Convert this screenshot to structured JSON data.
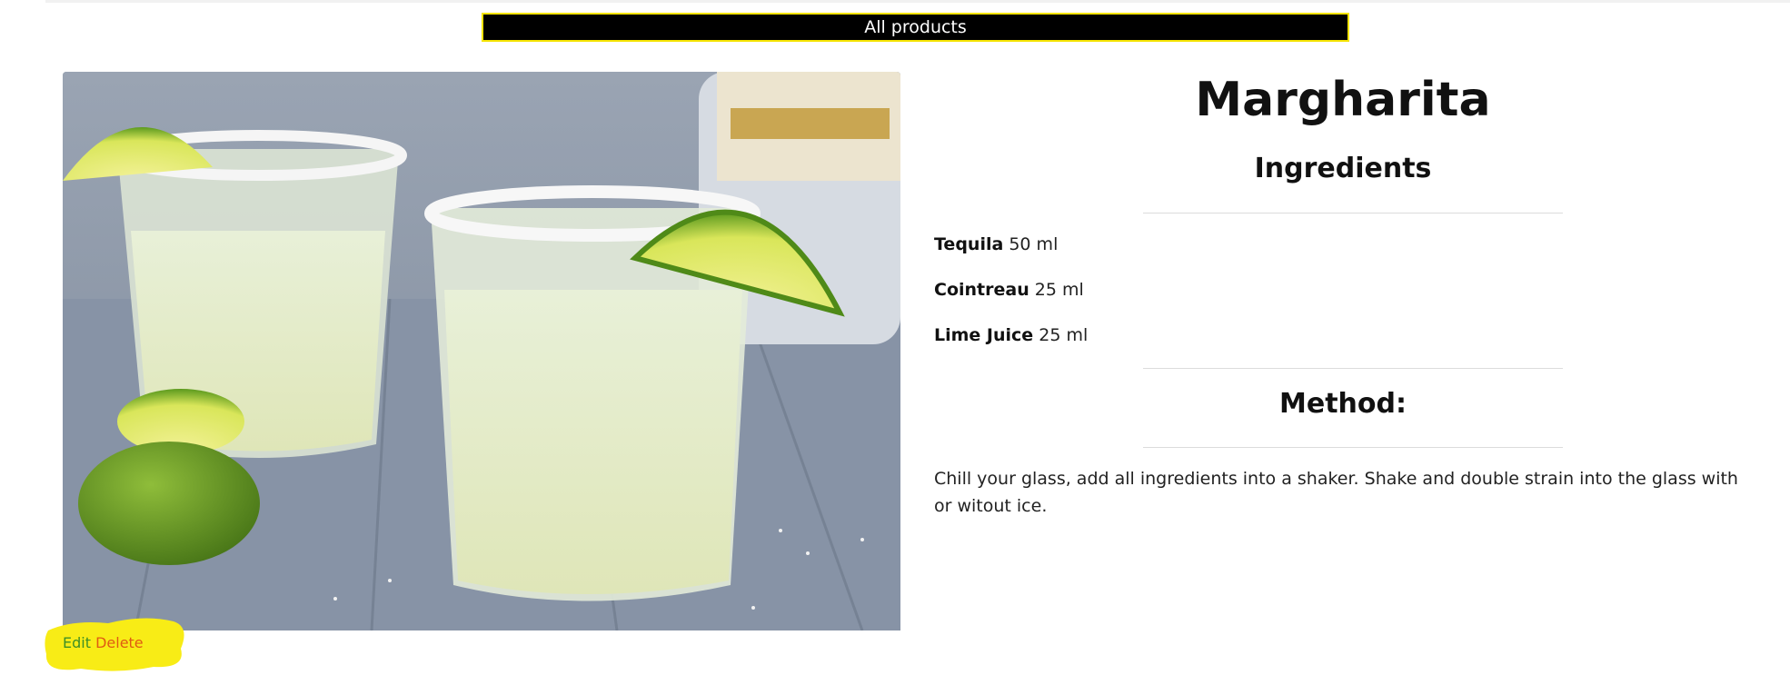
{
  "nav": {
    "all_products_label": "All products"
  },
  "product": {
    "name": "Margharita",
    "image_alt": "margarita cocktail",
    "ingredients_heading": "Ingredients",
    "ingredients": [
      {
        "name": "Tequila",
        "amount": "50 ml"
      },
      {
        "name": "Cointreau",
        "amount": "25 ml"
      },
      {
        "name": "Lime Juice",
        "amount": "25 ml"
      }
    ],
    "method_heading": "Method:",
    "method_text": "Chill your glass, add all ingredients into a shaker. Shake and double strain into the glass with or witout ice."
  },
  "actions": {
    "edit_label": "Edit",
    "delete_label": "Delete"
  },
  "colors": {
    "header_bg": "#000000",
    "header_border": "#f5e400",
    "highlight": "#f8ec16",
    "edit": "#3e8f26",
    "delete": "#e05b12"
  }
}
